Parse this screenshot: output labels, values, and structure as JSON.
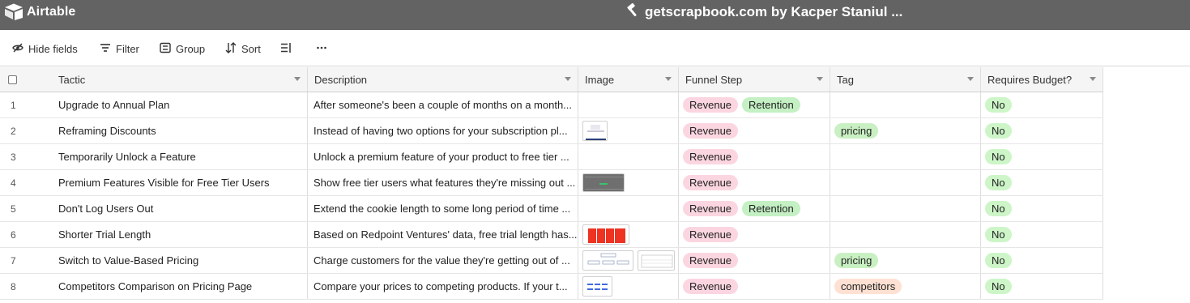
{
  "app": {
    "name": "Airtable",
    "base_title": "getscrapbook.com by Kacper Staniul ..."
  },
  "toolbar": {
    "hide_fields": "Hide fields",
    "filter": "Filter",
    "group": "Group",
    "sort": "Sort"
  },
  "columns": [
    {
      "label": "Tactic"
    },
    {
      "label": "Description"
    },
    {
      "label": "Image"
    },
    {
      "label": "Funnel Step"
    },
    {
      "label": "Tag"
    },
    {
      "label": "Requires Budget?"
    }
  ],
  "rows": [
    {
      "num": "1",
      "tactic": "Upgrade to Annual Plan",
      "description": "After someone's been a couple of months on a month...",
      "image": "",
      "funnel": [
        "Revenue",
        "Retention"
      ],
      "tag": "",
      "budget": "No"
    },
    {
      "num": "2",
      "tactic": "Reframing Discounts",
      "description": "Instead of having two options for your subscription pl...",
      "image": "pricing-table-thumbnail",
      "funnel": [
        "Revenue"
      ],
      "tag": "pricing",
      "budget": "No"
    },
    {
      "num": "3",
      "tactic": "Temporarily Unlock a Feature",
      "description": "Unlock a premium feature of your product to free tier ...",
      "image": "",
      "funnel": [
        "Revenue"
      ],
      "tag": "",
      "budget": "No"
    },
    {
      "num": "4",
      "tactic": "Premium Features Visible for Free Tier Users",
      "description": "Show free tier users what features they're missing out ...",
      "image": "dark-ui-thumbnail",
      "funnel": [
        "Revenue"
      ],
      "tag": "",
      "budget": "No"
    },
    {
      "num": "5",
      "tactic": "Don't Log Users Out",
      "description": "Extend the cookie length to some long period of time ...",
      "image": "",
      "funnel": [
        "Revenue",
        "Retention"
      ],
      "tag": "",
      "budget": "No"
    },
    {
      "num": "6",
      "tactic": "Shorter Trial Length",
      "description": "Based on Redpoint Ventures' data, free trial length has...",
      "image": "red-bar-chart-thumbnail",
      "funnel": [
        "Revenue"
      ],
      "tag": "",
      "budget": "No"
    },
    {
      "num": "7",
      "tactic": "Switch to Value-Based Pricing",
      "description": "Charge customers for the value they're getting out of ...",
      "image": "diagram-thumbnails",
      "funnel": [
        "Revenue"
      ],
      "tag": "pricing",
      "budget": "No"
    },
    {
      "num": "8",
      "tactic": "Competitors Comparison on Pricing Page",
      "description": "Compare your prices to competing products. If your t...",
      "image": "comparison-table-thumbnail",
      "funnel": [
        "Revenue"
      ],
      "tag": "competitors",
      "budget": "No"
    }
  ],
  "colors": {
    "topbar": "#636363",
    "revenue_pill": "#fbd6e0",
    "retention_pill": "#c4f0c4",
    "pricing_pill": "#c9f0c2",
    "competitors_pill": "#fee1d3",
    "no_pill": "#cdf5c8"
  },
  "icons": [
    "airtable-logo-icon",
    "hammer-icon",
    "hide-fields-icon",
    "filter-icon",
    "group-icon",
    "sort-icon",
    "row-height-icon",
    "more-icon"
  ]
}
